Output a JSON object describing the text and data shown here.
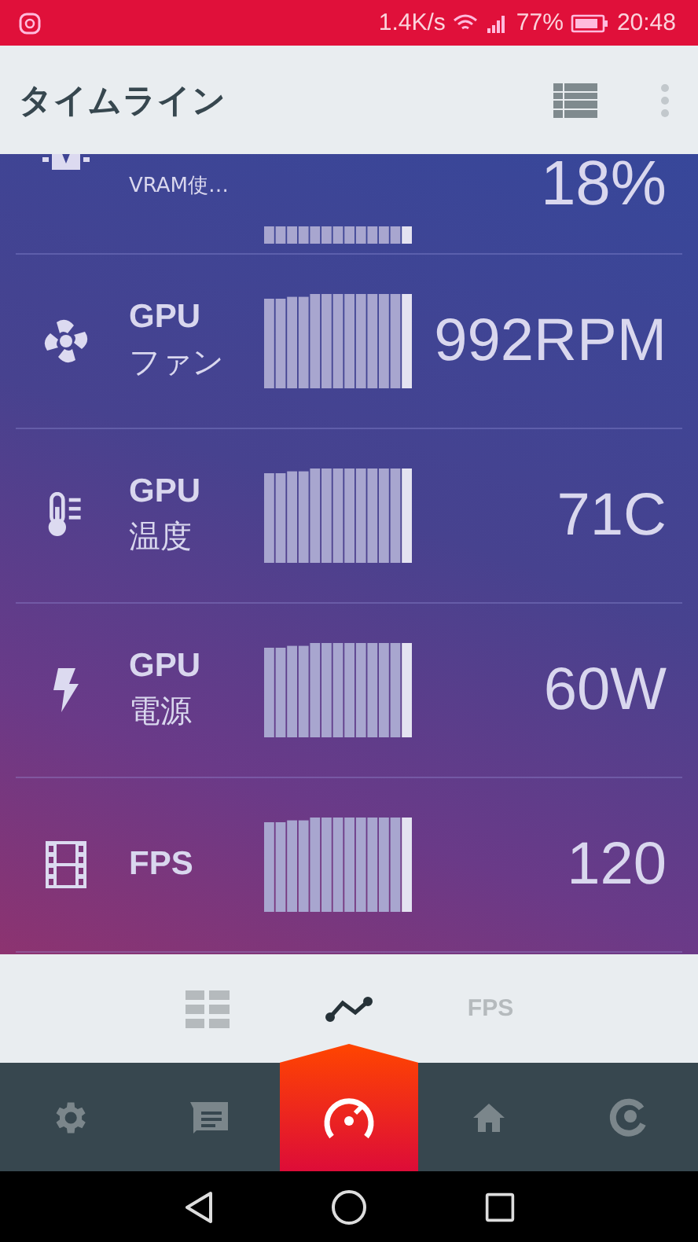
{
  "status_bar": {
    "speed": "1.4K/s",
    "battery": "77%",
    "time": "20:48"
  },
  "app_bar": {
    "title": "タイムライン"
  },
  "metrics": [
    {
      "kind": "vram",
      "label": "VRAM使…",
      "value": "18%"
    },
    {
      "kind": "fan",
      "title": "GPU",
      "label": "ファン",
      "value": "992RPM"
    },
    {
      "kind": "temperature",
      "title": "GPU",
      "label": "温度",
      "value": "71C"
    },
    {
      "kind": "power",
      "title": "GPU",
      "label": "電源",
      "value": "60W"
    },
    {
      "kind": "fps",
      "title": "FPS",
      "value": "120"
    }
  ],
  "tabs": [
    {
      "kind": "grid",
      "selected": false
    },
    {
      "kind": "chart",
      "selected": true
    },
    {
      "kind": "text",
      "label": "FPS",
      "selected": false
    }
  ],
  "bottom_nav": [
    {
      "kind": "settings",
      "selected": false
    },
    {
      "kind": "message",
      "selected": false
    },
    {
      "kind": "speedometer",
      "selected": true
    },
    {
      "kind": "home",
      "selected": false
    },
    {
      "kind": "target",
      "selected": false
    }
  ]
}
